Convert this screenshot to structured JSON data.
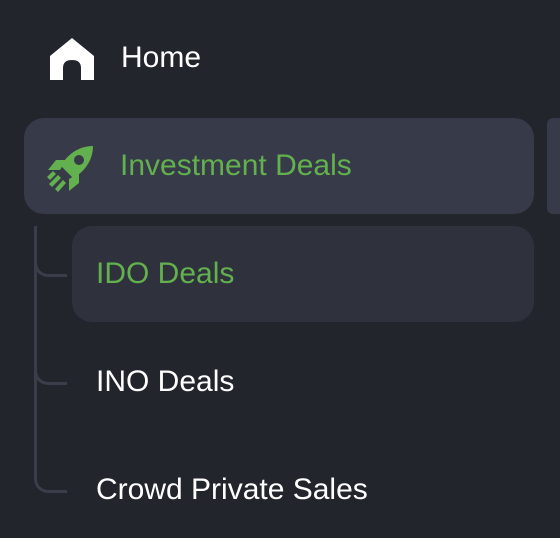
{
  "nav": {
    "home": {
      "label": "Home",
      "icon": "home-icon"
    },
    "investment_deals": {
      "label": "Investment Deals",
      "icon": "rocket-icon",
      "expanded": true,
      "children": [
        {
          "label": "IDO Deals",
          "active": true
        },
        {
          "label": "INO Deals",
          "active": false
        },
        {
          "label": "Crowd Private Sales",
          "active": false
        }
      ]
    }
  },
  "colors": {
    "background": "#23252d",
    "selected_item_bg": "#373a48",
    "active_sub_bg": "#2f323d",
    "accent_green": "#63b04e",
    "text": "#ffffff",
    "tree_line": "#3b3e4a"
  }
}
